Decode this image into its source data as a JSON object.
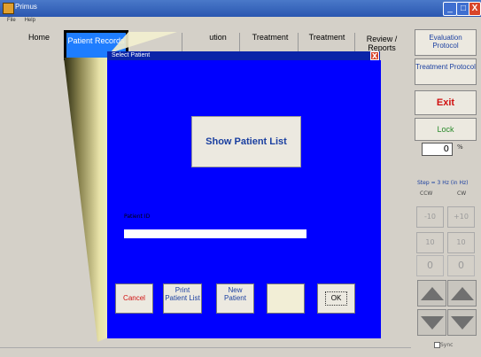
{
  "window": {
    "title": "Primus",
    "menu": [
      "File",
      "Help"
    ],
    "minimize": "_",
    "maximize": "□",
    "close": "X"
  },
  "tabs": [
    {
      "label": "Home"
    },
    {
      "label": "Patient Records",
      "active": true
    },
    {
      "label": "ution"
    },
    {
      "label": "Treatment"
    },
    {
      "label": "Treatment"
    },
    {
      "label": "Review / Reports"
    }
  ],
  "right_panel": {
    "evaluation_protocol": "Evaluation Protocol",
    "treatment_protocol": "Treatment Protocol",
    "exit": "Exit",
    "lock": "Lock",
    "zoom_value": "0",
    "zoom_unit": "%",
    "step_info": "Step = 3 Hz (in Hz)",
    "label_a": "CCW",
    "label_b": "CW",
    "minus10": "-10",
    "plus10": "+10",
    "ten_left": "10",
    "ten_right": "10",
    "pos_left": "0",
    "pos_right": "0",
    "sync_label": "Sync"
  },
  "dialog": {
    "title": "Select Patient",
    "close": "X",
    "show_patient_list": "Show Patient List",
    "patient_id_label": "Patient ID",
    "patient_id_value": "",
    "buttons": {
      "cancel": "Cancel",
      "print_list": "Print Patient List",
      "new_patient": "New Patient",
      "blank": "",
      "ok": "OK"
    }
  },
  "colors": {
    "dialog_bg": "#0000ff",
    "active_tab": "#1e7dff",
    "titlebar": "#2a56b0",
    "exit_text": "#d01010",
    "lock_text": "#2a8a2a"
  }
}
